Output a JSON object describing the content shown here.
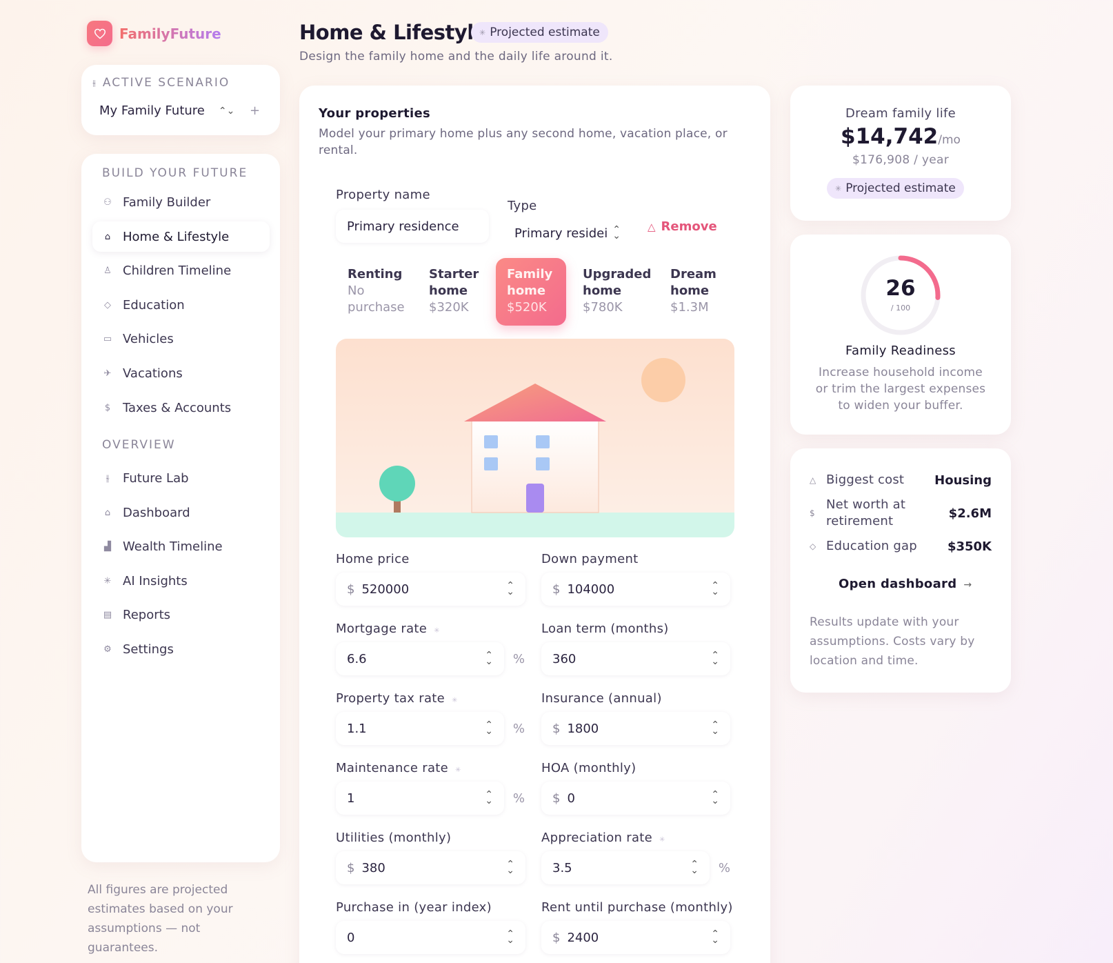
{
  "brand": {
    "name": "FamilyFuture",
    "logo_icon": "heart-icon"
  },
  "scenario": {
    "eyebrow": "ACTIVE SCENARIO",
    "selected": "My Family Future",
    "add_label": "+"
  },
  "sidebar": {
    "build_title": "BUILD YOUR FUTURE",
    "build_items": [
      {
        "label": "Family Builder",
        "icon": "people-icon"
      },
      {
        "label": "Home & Lifestyle",
        "icon": "home-icon",
        "active": true
      },
      {
        "label": "Children Timeline",
        "icon": "child-icon"
      },
      {
        "label": "Education",
        "icon": "graduation-cap-icon"
      },
      {
        "label": "Vehicles",
        "icon": "car-icon"
      },
      {
        "label": "Vacations",
        "icon": "plane-icon"
      },
      {
        "label": "Taxes & Accounts",
        "icon": "dollar-icon"
      }
    ],
    "overview_title": "OVERVIEW",
    "overview_items": [
      {
        "label": "Future Lab",
        "icon": "sliders-icon"
      },
      {
        "label": "Dashboard",
        "icon": "home-outline-icon"
      },
      {
        "label": "Wealth Timeline",
        "icon": "bar-chart-icon"
      },
      {
        "label": "AI Insights",
        "icon": "sparkle-icon"
      },
      {
        "label": "Reports",
        "icon": "document-icon"
      },
      {
        "label": "Settings",
        "icon": "gear-icon"
      }
    ],
    "footnote": "All figures are projected estimates based on your assumptions — not guarantees."
  },
  "header": {
    "title": "Home & Lifestyle",
    "badge": "Projected estimate",
    "subtitle": "Design the family home and the daily life around it."
  },
  "properties": {
    "title": "Your properties",
    "description": "Model your primary home plus any second home, vacation place, or rental.",
    "name_label": "Property name",
    "name_value": "Primary residence",
    "type_label": "Type",
    "type_value": "Primary residei",
    "remove_label": "Remove",
    "tiers": [
      {
        "name_line1": "Renting",
        "name_line2": "",
        "price": "No purchase"
      },
      {
        "name_line1": "Starter",
        "name_line2": "home",
        "price": "$320K"
      },
      {
        "name_line1": "Family",
        "name_line2": "home",
        "price": "$520K",
        "active": true
      },
      {
        "name_line1": "Upgraded",
        "name_line2": "home",
        "price": "$780K"
      },
      {
        "name_line1": "Dream",
        "name_line2": "home",
        "price": "$1.3M"
      }
    ],
    "fields": {
      "home_price": {
        "label": "Home price",
        "prefix": "$",
        "value": "520000"
      },
      "down_payment": {
        "label": "Down payment",
        "prefix": "$",
        "value": "104000"
      },
      "mortgage_rate": {
        "label": "Mortgage rate",
        "value": "6.6",
        "unit": "%"
      },
      "loan_term": {
        "label": "Loan term (months)",
        "value": "360"
      },
      "property_tax": {
        "label": "Property tax rate",
        "value": "1.1",
        "unit": "%"
      },
      "insurance": {
        "label": "Insurance (annual)",
        "prefix": "$",
        "value": "1800"
      },
      "maintenance": {
        "label": "Maintenance rate",
        "value": "1",
        "unit": "%"
      },
      "hoa": {
        "label": "HOA (monthly)",
        "prefix": "$",
        "value": "0"
      },
      "utilities": {
        "label": "Utilities (monthly)",
        "prefix": "$",
        "value": "380"
      },
      "appreciation": {
        "label": "Appreciation rate",
        "value": "3.5",
        "unit": "%"
      },
      "purchase_year": {
        "label": "Purchase in (year index)",
        "value": "0"
      },
      "rent_until": {
        "label": "Rent until purchase (monthly)",
        "prefix": "$",
        "value": "2400"
      }
    }
  },
  "dream": {
    "caption": "Dream family life",
    "monthly": "$14,742",
    "per": "/mo",
    "yearly": "$176,908 / year",
    "badge": "Projected estimate"
  },
  "readiness": {
    "score": 26,
    "max": "/ 100",
    "score_fraction": 0.26,
    "title": "Family Readiness",
    "description": "Increase household income or trim the largest expenses to widen your buffer."
  },
  "stats": {
    "items": [
      {
        "key": "Biggest cost",
        "value": "Housing",
        "icon": "warning-icon"
      },
      {
        "key": "Net worth at retirement",
        "value": "$2.6M",
        "icon": "dollar-icon"
      },
      {
        "key": "Education gap",
        "value": "$350K",
        "icon": "graduation-cap-icon"
      }
    ],
    "open_dashboard": "Open dashboard",
    "note": "Results update with your assumptions. Costs vary by location and time."
  },
  "colors": {
    "accent": "#f36b8d",
    "accent_light": "#fb8a86",
    "badge_bg": "#efe6fb",
    "teal": "#5fd6b8",
    "door": "#a98bf0",
    "window": "#a9c8f5"
  }
}
